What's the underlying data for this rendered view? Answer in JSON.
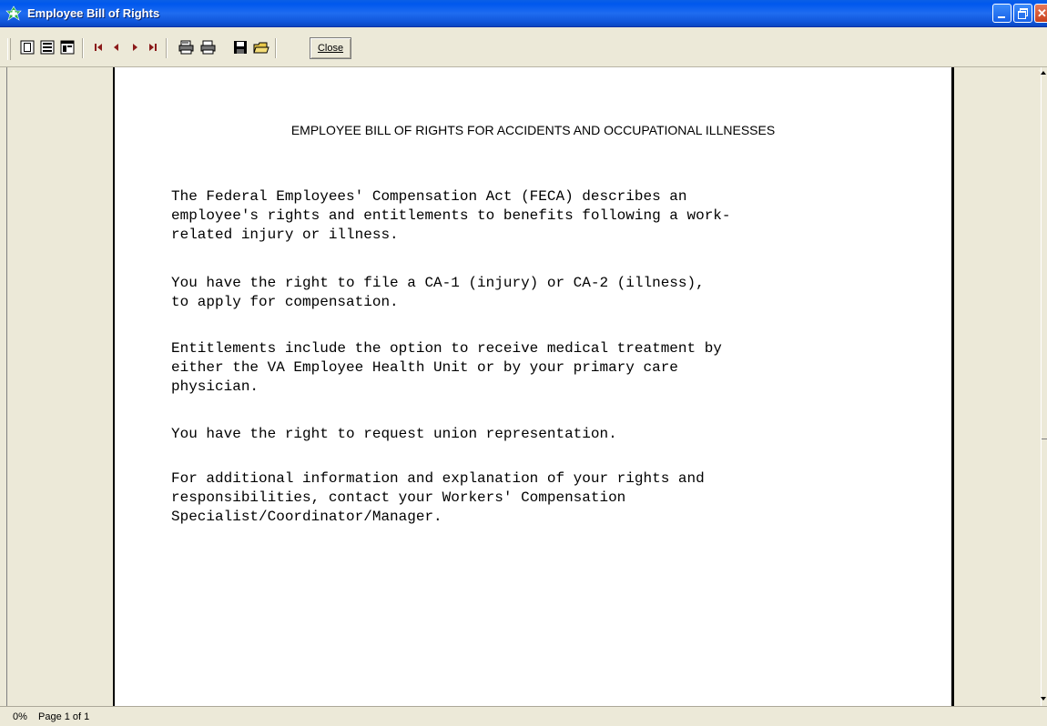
{
  "window": {
    "title": "Employee Bill of Rights"
  },
  "toolbar": {
    "icons": [
      "single-page-view-icon",
      "multi-page-view-icon",
      "toggle-tree-icon",
      "first-page-icon",
      "prev-page-icon",
      "next-page-icon",
      "last-page-icon",
      "print-setup-icon",
      "print-icon",
      "save-icon",
      "open-icon"
    ],
    "close_label": "Close"
  },
  "document": {
    "title": "EMPLOYEE BILL OF RIGHTS FOR ACCIDENTS AND OCCUPATIONAL ILLNESSES",
    "paragraphs": [
      "The Federal Employees' Compensation Act (FECA) describes an\nemployee's rights and entitlements to benefits following a work-\nrelated injury or illness.",
      "You have the right to file a CA-1 (injury) or CA-2 (illness),\nto apply for compensation.",
      "Entitlements include the option to receive medical treatment by\neither the VA Employee Health Unit or by your primary care\nphysician.",
      "You have the right to request union representation.",
      "For additional information and explanation of your rights and\nresponsibilities, contact your Workers' Compensation\nSpecialist/Coordinator/Manager."
    ]
  },
  "status": {
    "zoom": "0%",
    "page": "Page 1 of 1"
  },
  "colors": {
    "title_bar": "#0058ee",
    "chrome": "#ece9d8",
    "page": "#ffffff"
  }
}
